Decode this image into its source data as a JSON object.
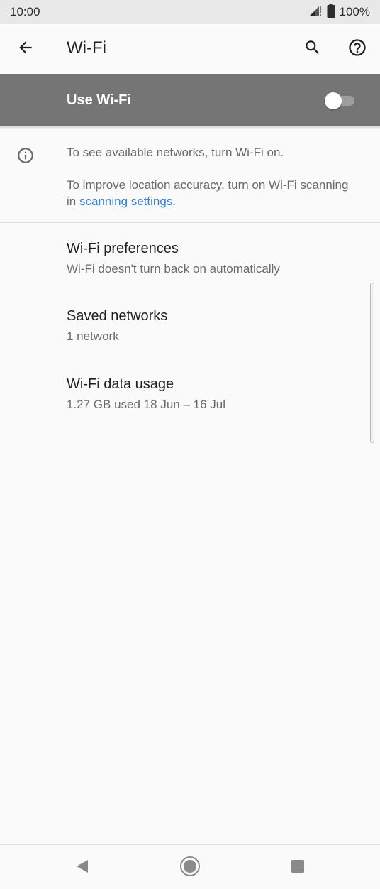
{
  "status_bar": {
    "time": "10:00",
    "battery": "100%",
    "icons": [
      "signal-icon",
      "battery-icon"
    ]
  },
  "app_bar": {
    "title": "Wi-Fi",
    "icons": [
      "back-arrow-icon",
      "search-icon",
      "help-icon"
    ]
  },
  "master_switch": {
    "label": "Use Wi-Fi",
    "state": "off"
  },
  "info": {
    "icon": "info-icon",
    "line1": "To see available networks, turn Wi-Fi on.",
    "line2_prefix": "To improve location accuracy, turn on Wi-Fi scanning in ",
    "line2_link": "scanning settings",
    "line2_suffix": ".",
    "link_color": "#3a7fd5"
  },
  "items": [
    {
      "title": "Wi-Fi preferences",
      "subtitle": "Wi-Fi doesn't turn back on automatically"
    },
    {
      "title": "Saved networks",
      "subtitle": "1 network"
    },
    {
      "title": "Wi-Fi data usage",
      "subtitle": "1.27 GB used 18 Jun – 16 Jul"
    }
  ],
  "nav_bar": {
    "icons": [
      "nav-back-icon",
      "nav-home-icon",
      "nav-recents-icon"
    ]
  },
  "colors": {
    "master_bar": "#757575",
    "status_bar": "#e8e8e8",
    "background": "#fafafa"
  }
}
